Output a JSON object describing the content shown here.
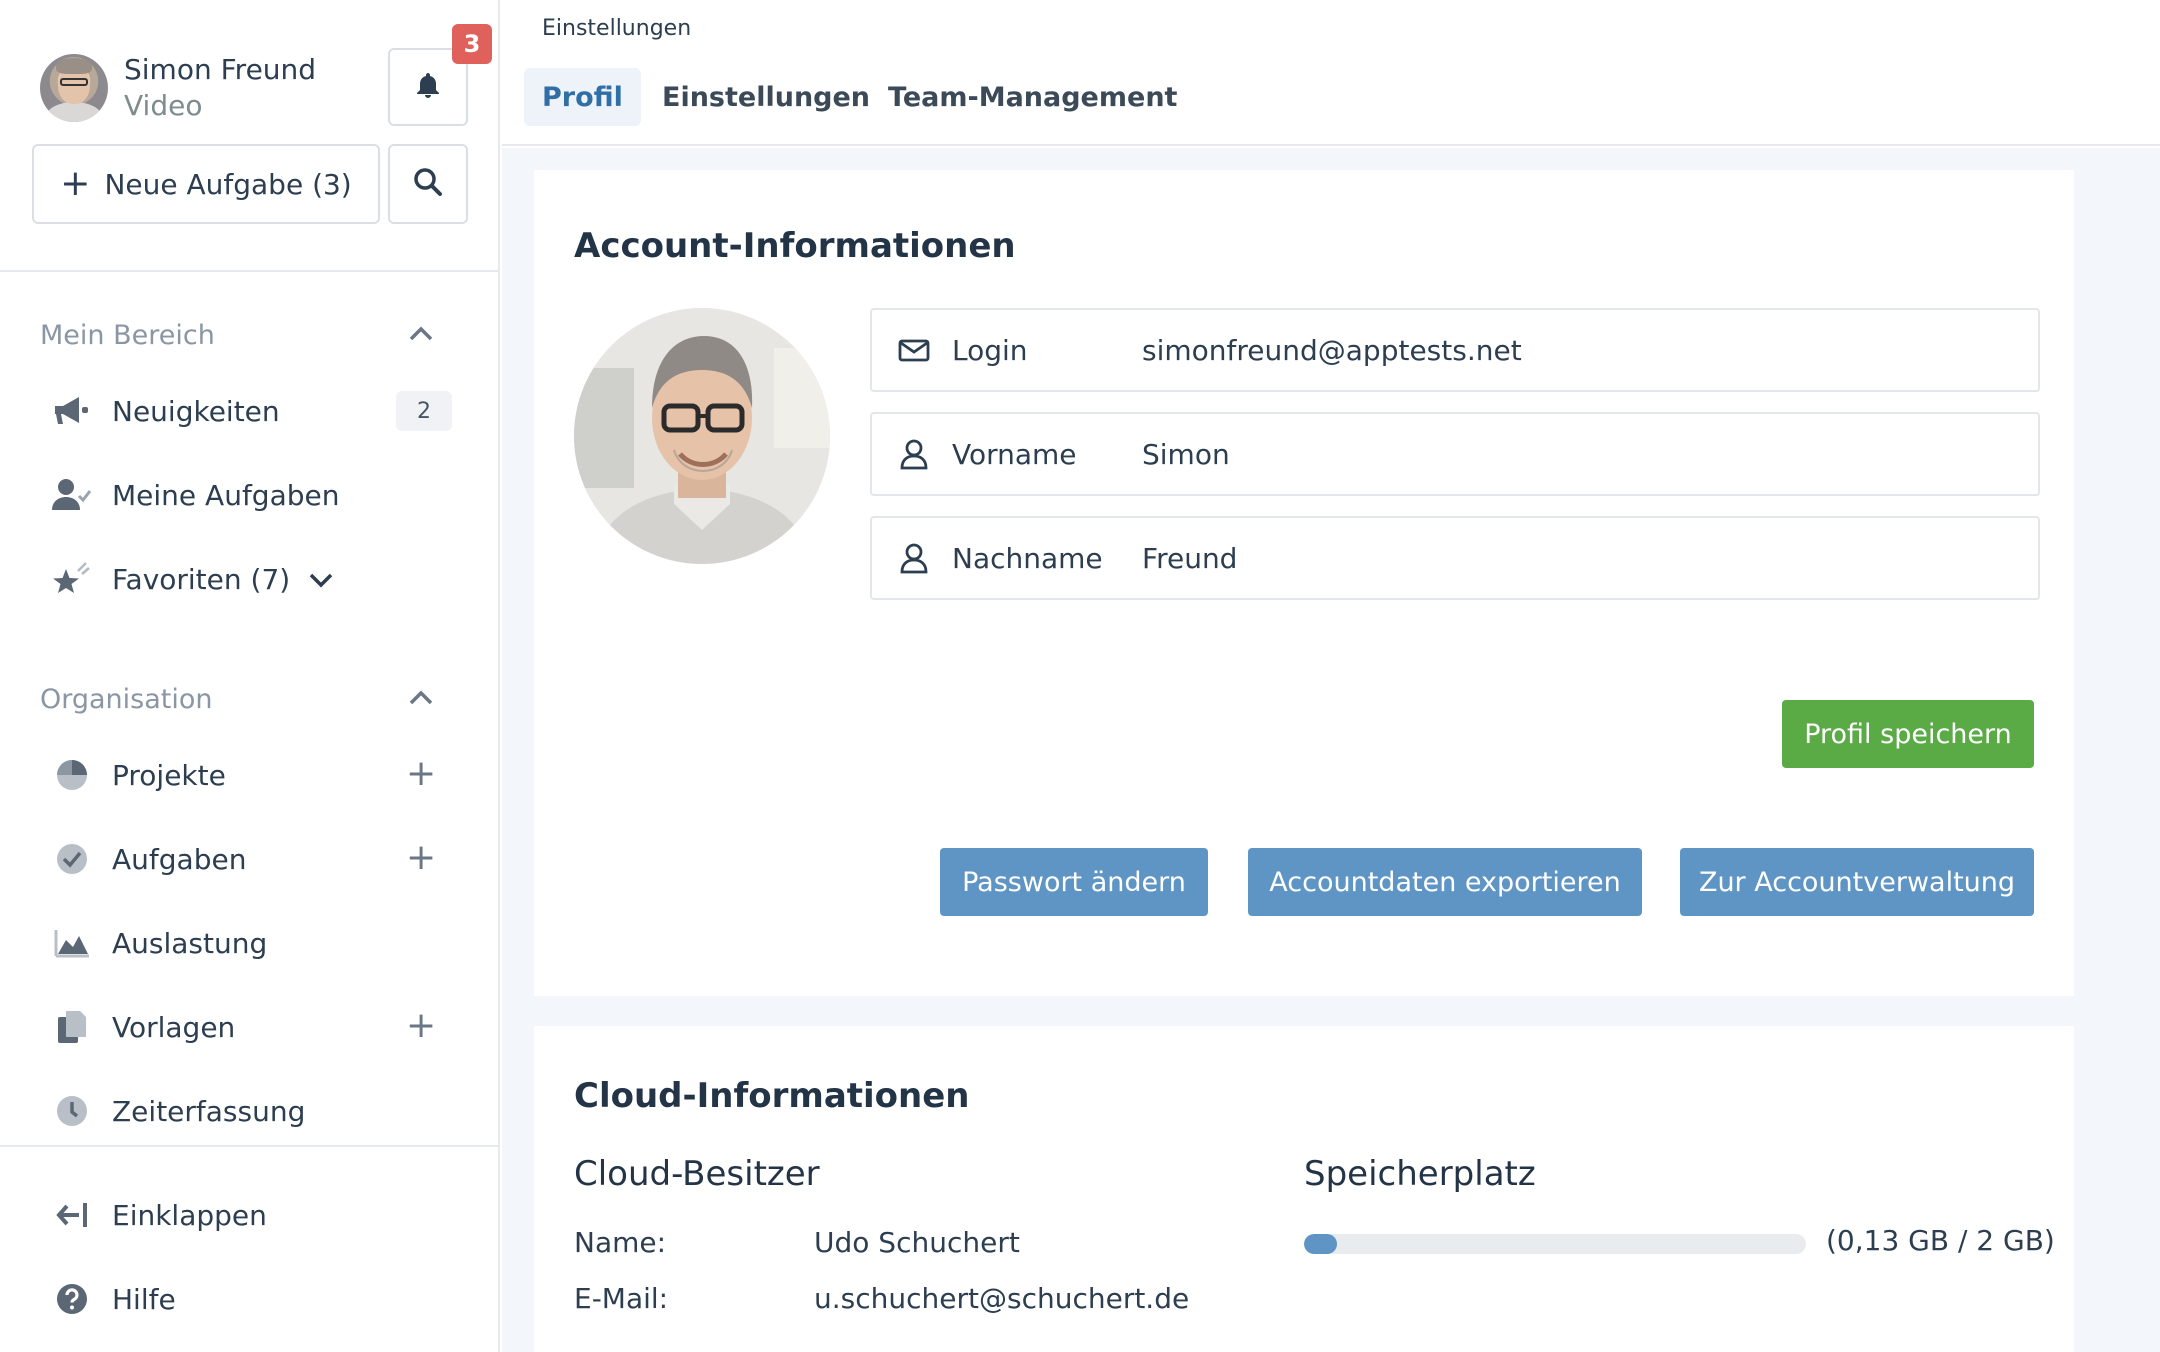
{
  "user": {
    "name": "Simon Freund",
    "subtitle": "Video",
    "notification_count": "3"
  },
  "sidebar": {
    "new_task_label": "Neue Aufgabe (3)",
    "sections": [
      {
        "title": "Mein Bereich",
        "items": [
          {
            "label": "Neuigkeiten",
            "icon": "megaphone-icon",
            "count": "2"
          },
          {
            "label": "Meine Aufgaben",
            "icon": "user-check-icon"
          },
          {
            "label": "Favoriten (7)",
            "icon": "star-icon"
          }
        ]
      },
      {
        "title": "Organisation",
        "items": [
          {
            "label": "Projekte",
            "icon": "pie-chart-icon"
          },
          {
            "label": "Aufgaben",
            "icon": "check-circle-icon"
          },
          {
            "label": "Auslastung",
            "icon": "area-chart-icon"
          },
          {
            "label": "Vorlagen",
            "icon": "copy-icon"
          },
          {
            "label": "Zeiterfassung",
            "icon": "clock-icon"
          }
        ]
      }
    ],
    "footer": [
      {
        "label": "Einklappen",
        "icon": "collapse-icon"
      },
      {
        "label": "Hilfe",
        "icon": "help-icon"
      }
    ]
  },
  "header": {
    "breadcrumb": "Einstellungen",
    "tabs": [
      {
        "label": "Profil",
        "active": true
      },
      {
        "label": "Einstellungen",
        "active": false
      },
      {
        "label": "Team-Management",
        "active": false
      }
    ]
  },
  "account": {
    "title": "Account-Informationen",
    "fields": [
      {
        "label": "Login",
        "value": "simonfreund@apptests.net",
        "icon": "envelope-icon"
      },
      {
        "label": "Vorname",
        "value": "Simon",
        "icon": "user-icon"
      },
      {
        "label": "Nachname",
        "value": "Freund",
        "icon": "user-icon"
      }
    ],
    "save_label": "Profil speichern",
    "actions": [
      {
        "label": "Passwort ändern"
      },
      {
        "label": "Accountdaten exportieren"
      },
      {
        "label": "Zur Accountverwaltung"
      }
    ]
  },
  "cloud": {
    "title": "Cloud-Informationen",
    "owner_heading": "Cloud-Besitzer",
    "name_label": "Name:",
    "name_value": "Udo Schuchert",
    "email_label": "E-Mail:",
    "email_value": "u.schuchert@schuchert.de",
    "storage_heading": "Speicherplatz",
    "storage_text": "(0,13 GB / 2 GB)",
    "storage_fraction": 0.065
  },
  "colors": {
    "accent_blue": "#5e95c4",
    "save_green": "#5aab46",
    "badge_red": "#e0605b"
  }
}
